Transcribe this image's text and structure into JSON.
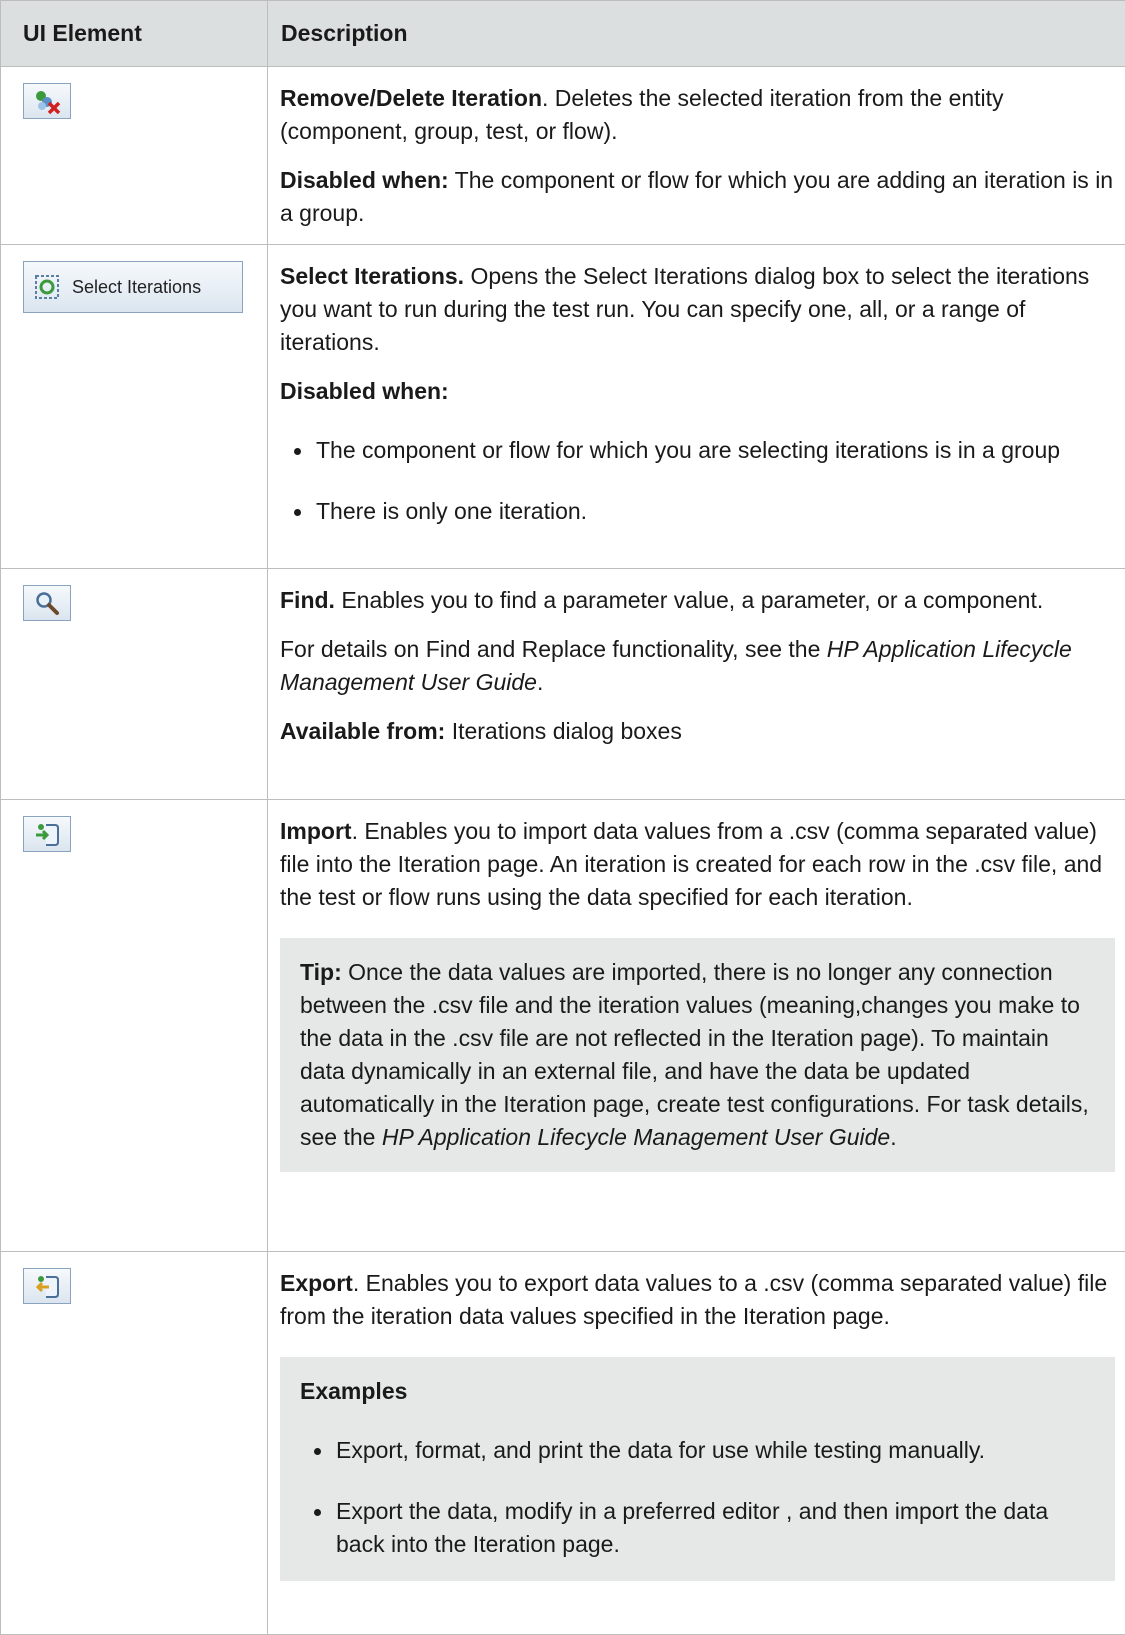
{
  "header": {
    "col1": "UI Element",
    "col2": "Description"
  },
  "rows": {
    "remove": {
      "icon": "remove-iteration-icon",
      "title": "Remove/Delete Iteration",
      "text": ". Deletes the selected iteration from the entity (component, group, test, or flow).",
      "disabled_label": "Disabled when:",
      "disabled_text": " The component or flow for which you are adding an iteration is in a group."
    },
    "select": {
      "icon": "select-iterations-icon",
      "button_label": "Select Iterations",
      "title": "Select Iterations.",
      "text": " Opens the Select Iterations dialog box to select the iterations you want to run during the test run. You can specify one, all, or a range of iterations.",
      "disabled_label": "Disabled when:",
      "bullets": [
        "The component or flow for which you are selecting iterations is in a group",
        "There is only one iteration."
      ]
    },
    "find": {
      "icon": "find-icon",
      "title": "Find.",
      "text": " Enables you to find a parameter value, a parameter, or a component.",
      "details_pre": "For details on Find and Replace functionality, see the ",
      "details_italic": "HP Application Lifecycle Management User Guide",
      "details_post": ".",
      "available_label": "Available from:",
      "available_text": " Iterations dialog boxes"
    },
    "import": {
      "icon": "import-icon",
      "title": "Import",
      "text": ". Enables you to import data values from a .csv (comma separated value) file into the Iteration page. An iteration is created for each row in the .csv file, and the test or flow runs using the data specified for each iteration.",
      "tip_label": "Tip:",
      "tip_text": " Once the data values are imported, there is no longer any connection between the .csv file and the iteration values (meaning,changes you make to the data in the .csv file are not reflected in the Iteration page). To maintain data dynamically in an external file, and have the data be updated automatically in the Iteration page, create test configurations. For task details, see the ",
      "tip_italic": "HP Application Lifecycle Management User Guide",
      "tip_post": "."
    },
    "export": {
      "icon": "export-icon",
      "title": "Export",
      "text": ". Enables you to export data values to a .csv (comma separated value) file from the iteration data values specified in the Iteration page.",
      "examples_label": "Examples",
      "bullets": [
        "Export, format, and print the data for use while testing manually.",
        "Export the data, modify in a preferred editor , and then import the data back into the Iteration page."
      ]
    }
  }
}
